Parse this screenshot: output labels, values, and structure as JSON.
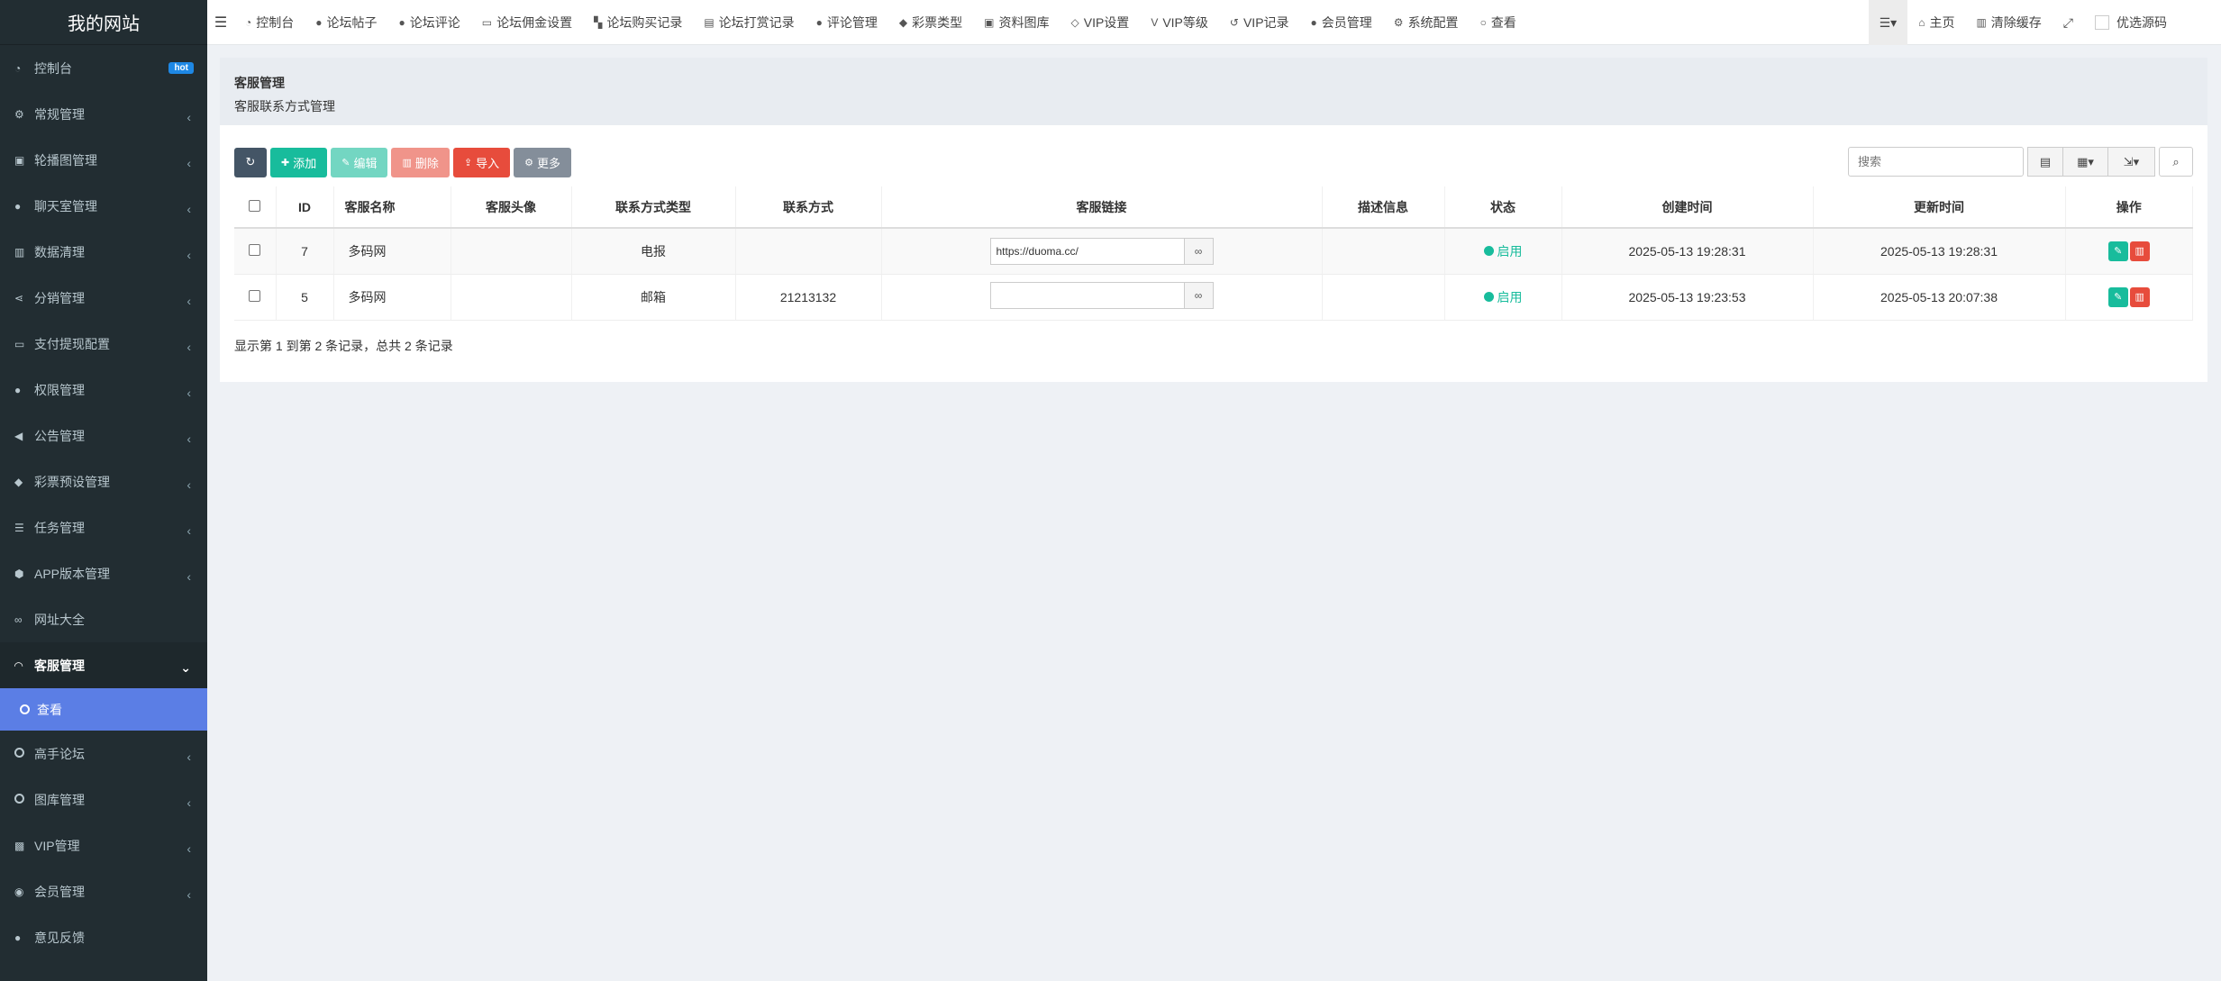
{
  "sidebar": {
    "brand": "我的网站",
    "items": [
      {
        "label": "控制台",
        "icon": "dashboard-icon",
        "glyph": "◔",
        "badge": "hot"
      },
      {
        "label": "常规管理",
        "icon": "cogs-icon",
        "glyph": "⚙",
        "caret": "‹"
      },
      {
        "label": "轮播图管理",
        "icon": "image-icon",
        "glyph": "▣",
        "caret": "‹"
      },
      {
        "label": "聊天室管理",
        "icon": "comments-icon",
        "glyph": "●",
        "caret": "‹"
      },
      {
        "label": "数据清理",
        "icon": "trash-icon",
        "glyph": "▥",
        "caret": "‹"
      },
      {
        "label": "分销管理",
        "icon": "share-icon",
        "glyph": "⋖",
        "caret": "‹"
      },
      {
        "label": "支付提现配置",
        "icon": "money-icon",
        "glyph": "▭",
        "caret": "‹"
      },
      {
        "label": "权限管理",
        "icon": "users-icon",
        "glyph": "●",
        "caret": "‹"
      },
      {
        "label": "公告管理",
        "icon": "bullhorn-icon",
        "glyph": "◀",
        "caret": "‹"
      },
      {
        "label": "彩票预设管理",
        "icon": "ticket-icon",
        "glyph": "◆",
        "caret": "‹"
      },
      {
        "label": "任务管理",
        "icon": "list-icon",
        "glyph": "☰",
        "caret": "‹"
      },
      {
        "label": "APP版本管理",
        "icon": "android-icon",
        "glyph": "⬢",
        "caret": "‹"
      },
      {
        "label": "网址大全",
        "icon": "link-icon",
        "glyph": "∞"
      },
      {
        "label": "客服管理",
        "icon": "headphones-icon",
        "glyph": "◠",
        "caret": "⌄",
        "open": true
      },
      {
        "label": "高手论坛",
        "icon": "circle-o-icon",
        "glyph": "",
        "caret": "‹"
      },
      {
        "label": "图库管理",
        "icon": "circle-o-icon",
        "glyph": "",
        "caret": "‹"
      },
      {
        "label": "VIP管理",
        "icon": "gamepad-icon",
        "glyph": "▩",
        "caret": "‹"
      },
      {
        "label": "会员管理",
        "icon": "user-circle-icon",
        "glyph": "◉",
        "caret": "‹"
      },
      {
        "label": "意见反馈",
        "icon": "comment-icon",
        "glyph": "●"
      }
    ],
    "sub_item": {
      "label": "查看",
      "icon": "circle-o-icon"
    }
  },
  "topbar": {
    "nav": [
      {
        "label": "控制台",
        "icon": "dashboard-icon",
        "glyph": "◔"
      },
      {
        "label": "论坛帖子",
        "icon": "comment-icon",
        "glyph": "●"
      },
      {
        "label": "论坛评论",
        "icon": "comments-icon",
        "glyph": "●"
      },
      {
        "label": "论坛佣金设置",
        "icon": "money-icon",
        "glyph": "▭"
      },
      {
        "label": "论坛购买记录",
        "icon": "cart-icon",
        "glyph": "▚"
      },
      {
        "label": "论坛打赏记录",
        "icon": "gift-icon",
        "glyph": "▤"
      },
      {
        "label": "评论管理",
        "icon": "comments-icon",
        "glyph": "●"
      },
      {
        "label": "彩票类型",
        "icon": "ticket-icon",
        "glyph": "◆"
      },
      {
        "label": "资料图库",
        "icon": "image-icon",
        "glyph": "▣"
      },
      {
        "label": "VIP设置",
        "icon": "diamond-icon",
        "glyph": "◇"
      },
      {
        "label": "VIP等级",
        "icon": "vimeo-icon",
        "glyph": "V"
      },
      {
        "label": "VIP记录",
        "icon": "history-icon",
        "glyph": "↺"
      },
      {
        "label": "会员管理",
        "icon": "user-icon",
        "glyph": "●"
      },
      {
        "label": "系统配置",
        "icon": "gear-icon",
        "glyph": "⚙"
      },
      {
        "label": "查看",
        "icon": "circle-o-icon",
        "glyph": "○"
      }
    ],
    "right": {
      "menu_icon": "☰▾",
      "home": "主页",
      "clear_cache": "清除缓存",
      "fullscreen_icon": "⤢",
      "user": "优选源码"
    }
  },
  "page_header": {
    "title": "客服管理",
    "subtitle": "客服联系方式管理"
  },
  "toolbar": {
    "refresh_icon": "↻",
    "add": "添加",
    "edit": "编辑",
    "delete": "删除",
    "import": "导入",
    "more": "更多",
    "search_placeholder": "搜索"
  },
  "table": {
    "headers": {
      "id": "ID",
      "name": "客服名称",
      "avatar": "客服头像",
      "contact_type": "联系方式类型",
      "contact": "联系方式",
      "link": "客服链接",
      "desc": "描述信息",
      "status": "状态",
      "created": "创建时间",
      "updated": "更新时间",
      "ops": "操作"
    },
    "rows": [
      {
        "id": "7",
        "name": "多码网",
        "avatar": "",
        "contact_type": "电报",
        "contact": "",
        "link": "https://duoma.cc/",
        "desc": "",
        "status": "启用",
        "created": "2025-05-13 19:28:31",
        "updated": "2025-05-13 19:28:31"
      },
      {
        "id": "5",
        "name": "多码网",
        "avatar": "",
        "contact_type": "邮箱",
        "contact": "21213132",
        "link": "",
        "desc": "",
        "status": "启用",
        "created": "2025-05-13 19:23:53",
        "updated": "2025-05-13 20:07:38"
      }
    ]
  },
  "pager_info": "显示第 1 到第 2 条记录，总共 2 条记录",
  "colors": {
    "sidebar_bg": "#222d32",
    "active_sub_bg": "#5b7ee5",
    "green": "#18bc9c",
    "red": "#e74c3c"
  }
}
